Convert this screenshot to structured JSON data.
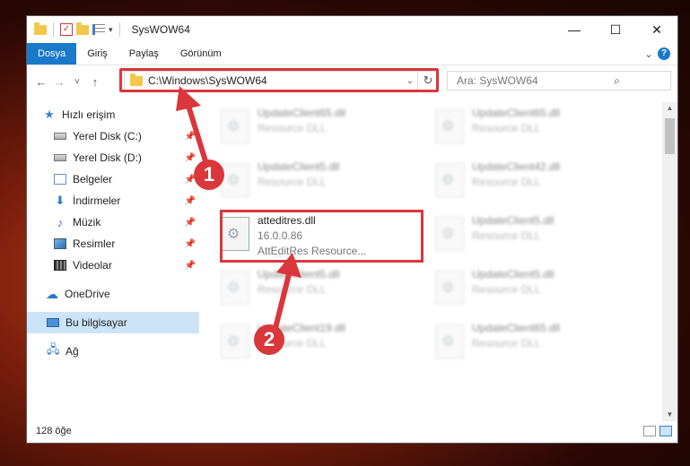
{
  "window": {
    "title": "SysWOW64",
    "minimize": "—",
    "maximize": "☐",
    "close": "✕"
  },
  "ribbon": {
    "tabs": [
      {
        "label": "Dosya",
        "active": true
      },
      {
        "label": "Giriş"
      },
      {
        "label": "Paylaş"
      },
      {
        "label": "Görünüm"
      }
    ],
    "expand_icon": "chevron-down-icon",
    "help_icon": "help-icon",
    "help_glyph": "?"
  },
  "navbar": {
    "back": "←",
    "forward": "→",
    "recent": "˅",
    "up": "↑",
    "address": "C:\\Windows\\SysWOW64",
    "search_placeholder": "Ara: SysWOW64"
  },
  "sidebar": {
    "items": [
      {
        "label": "Hızlı erişim",
        "icon": "star-icon",
        "pinned": false
      },
      {
        "label": "Yerel Disk (C:)",
        "icon": "disk-icon",
        "pinned": true
      },
      {
        "label": "Yerel Disk (D:)",
        "icon": "disk-icon",
        "pinned": true
      },
      {
        "label": "Belgeler",
        "icon": "documents-icon",
        "pinned": true
      },
      {
        "label": "İndirmeler",
        "icon": "download-icon",
        "pinned": true
      },
      {
        "label": "Müzik",
        "icon": "music-icon",
        "pinned": true
      },
      {
        "label": "Resimler",
        "icon": "pictures-icon",
        "pinned": true
      },
      {
        "label": "Videolar",
        "icon": "videos-icon",
        "pinned": true
      },
      {
        "label": "OneDrive",
        "icon": "cloud-icon",
        "pinned": false
      },
      {
        "label": "Bu bilgisayar",
        "icon": "computer-icon",
        "pinned": false,
        "selected": true
      },
      {
        "label": "Ağ",
        "icon": "network-icon",
        "pinned": false
      }
    ]
  },
  "files": [
    {
      "name": "UpdateClient65.dll",
      "type": "Resource DLL",
      "blurred": true
    },
    {
      "name": "UpdateClient65.dll",
      "type": "Resource DLL",
      "blurred": true
    },
    {
      "name": "UpdateClient5.dll",
      "type": "Resource DLL",
      "blurred": true
    },
    {
      "name": "UpdateClient42.dll",
      "type": "Resource DLL",
      "blurred": true
    },
    {
      "name": "atteditres.dll",
      "version": "16.0.0.86",
      "type": "AttEditRes Resource...",
      "blurred": false,
      "selected": true
    },
    {
      "name": "UpdateClient5.dll",
      "type": "Resource DLL",
      "blurred": true
    },
    {
      "name": "UpdateClient5.dll",
      "type": "Resource DLL",
      "blurred": true
    },
    {
      "name": "UpdateClient5.dll",
      "type": "Resource DLL",
      "blurred": true
    },
    {
      "name": "UpdateClient19.dll",
      "type": "Resource DLL",
      "blurred": true
    },
    {
      "name": "UpdateClient65.dll",
      "type": "Resource DLL",
      "blurred": true
    }
  ],
  "status": {
    "count": "128 öğe"
  },
  "annotations": {
    "step1": "1",
    "step2": "2",
    "color": "#d9373b"
  }
}
